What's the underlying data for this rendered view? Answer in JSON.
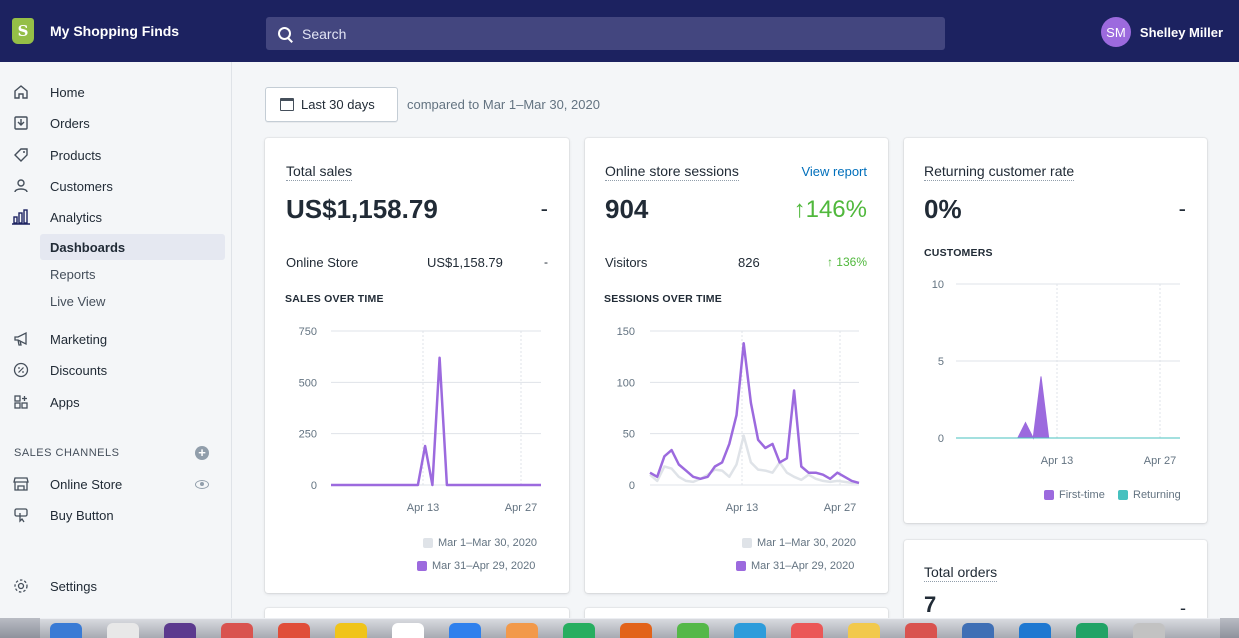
{
  "topbar": {
    "store_name": "My Shopping Finds",
    "search_placeholder": "Search",
    "user_initials": "SM",
    "user_name": "Shelley Miller"
  },
  "sidebar": {
    "items": [
      {
        "label": "Home",
        "icon": "home-icon"
      },
      {
        "label": "Orders",
        "icon": "orders-icon"
      },
      {
        "label": "Products",
        "icon": "tag-icon"
      },
      {
        "label": "Customers",
        "icon": "person-icon"
      },
      {
        "label": "Analytics",
        "icon": "bar-chart-icon"
      }
    ],
    "analytics_sub": [
      "Dashboards",
      "Reports",
      "Live View"
    ],
    "items2": [
      {
        "label": "Marketing",
        "icon": "megaphone-icon"
      },
      {
        "label": "Discounts",
        "icon": "percent-icon"
      },
      {
        "label": "Apps",
        "icon": "apps-icon"
      }
    ],
    "sales_channels_title": "SALES CHANNELS",
    "channels": [
      {
        "label": "Online Store",
        "icon": "store-icon"
      },
      {
        "label": "Buy Button",
        "icon": "buy-button-icon"
      }
    ],
    "settings_label": "Settings"
  },
  "filters": {
    "date_range": "Last 30 days",
    "compare_text": "compared to Mar 1–Mar 30, 2020"
  },
  "cards": {
    "total_sales": {
      "title": "Total sales",
      "value": "US$1,158.79",
      "delta": "-",
      "row_label": "Online Store",
      "row_value": "US$1,158.79",
      "row_delta": "-",
      "chart_label": "SALES OVER TIME",
      "legend": [
        "Mar 1–Mar 30, 2020",
        "Mar 31–Apr 29, 2020"
      ]
    },
    "sessions": {
      "title": "Online store sessions",
      "link": "View report",
      "value": "904",
      "delta": "↑146%",
      "row_label": "Visitors",
      "row_value": "826",
      "row_delta": "↑ 136%",
      "chart_label": "SESSIONS OVER TIME",
      "legend": [
        "Mar 1–Mar 30, 2020",
        "Mar 31–Apr 29, 2020"
      ]
    },
    "returning": {
      "title": "Returning customer rate",
      "value": "0%",
      "delta": "-",
      "chart_label": "CUSTOMERS",
      "legend": [
        "First-time",
        "Returning"
      ]
    },
    "total_orders": {
      "title": "Total orders",
      "value": "7",
      "delta": "-"
    }
  },
  "colors": {
    "topbar": "#1c2260",
    "current_period": "#9c6ade",
    "previous_period": "#dfe3e8",
    "returning": "#47c1bf",
    "positive": "#50b83c"
  },
  "chart_data": [
    {
      "type": "line",
      "title": "SALES OVER TIME",
      "x_ticks": [
        "Apr 13",
        "Apr 27"
      ],
      "ylim": [
        0,
        750
      ],
      "y_ticks": [
        0,
        250,
        500,
        750
      ],
      "series": [
        {
          "name": "Mar 31–Apr 29, 2020",
          "values": [
            0,
            0,
            0,
            0,
            0,
            0,
            0,
            0,
            0,
            0,
            0,
            0,
            0,
            190,
            0,
            620,
            0,
            0,
            0,
            0,
            0,
            0,
            0,
            0,
            0,
            0,
            0,
            0,
            0,
            0
          ]
        }
      ]
    },
    {
      "type": "line",
      "title": "SESSIONS OVER TIME",
      "x_ticks": [
        "Apr 13",
        "Apr 27"
      ],
      "ylim": [
        0,
        150
      ],
      "y_ticks": [
        0,
        50,
        100,
        150
      ],
      "series": [
        {
          "name": "Mar 1–Mar 30, 2020",
          "values": [
            10,
            4,
            18,
            16,
            8,
            4,
            3,
            6,
            10,
            15,
            14,
            8,
            20,
            48,
            22,
            15,
            14,
            12,
            22,
            12,
            8,
            5,
            10,
            6,
            4,
            3,
            4,
            3,
            2,
            2
          ]
        },
        {
          "name": "Mar 31–Apr 29, 2020",
          "values": [
            12,
            8,
            28,
            34,
            20,
            14,
            8,
            6,
            8,
            18,
            22,
            40,
            68,
            138,
            80,
            44,
            36,
            40,
            22,
            26,
            92,
            18,
            12,
            12,
            10,
            6,
            12,
            8,
            4,
            2
          ]
        }
      ]
    },
    {
      "type": "area",
      "title": "CUSTOMERS",
      "x_ticks": [
        "Apr 13",
        "Apr 27"
      ],
      "ylim": [
        0,
        10
      ],
      "y_ticks": [
        0,
        5,
        10
      ],
      "series": [
        {
          "name": "First-time",
          "values": [
            0,
            0,
            0,
            0,
            0,
            0,
            0,
            0,
            0,
            1,
            0,
            4,
            0,
            0,
            0,
            0,
            0,
            0,
            0,
            0,
            0,
            0,
            0,
            0,
            0,
            0,
            0,
            0,
            0,
            0
          ]
        },
        {
          "name": "Returning",
          "values": [
            0,
            0,
            0,
            0,
            0,
            0,
            0,
            0,
            0,
            0,
            0,
            0,
            0,
            0,
            0,
            0,
            0,
            0,
            0,
            0,
            0,
            0,
            0,
            0,
            0,
            0,
            0,
            0,
            0,
            0
          ]
        }
      ]
    }
  ]
}
